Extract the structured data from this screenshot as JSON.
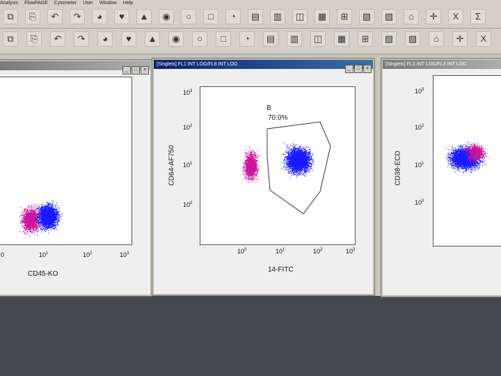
{
  "menu": {
    "items": [
      "Analysis",
      "FlowPAGE",
      "Cytometer",
      "User",
      "Window",
      "Help"
    ]
  },
  "toolbar": {
    "row1_icons": [
      "copy-icon",
      "paste-icon",
      "undo-icon",
      "redo-icon",
      "color-wheel-icon",
      "heart-icon",
      "shape-icon",
      "palette-icon",
      "circle-gate-icon",
      "square-gate-icon",
      "ellipse-gate-icon",
      "chart-a-icon",
      "grid-icon",
      "split-icon",
      "bars-icon",
      "quad-icon",
      "strike-icon",
      "rainbow-icon",
      "house-icon",
      "crosshair-icon",
      "excel-icon",
      "sigma-icon"
    ],
    "row2_icons": [
      "arrows-icon",
      "arrange-icon",
      "sort-icon",
      "distribute-icon",
      "align-left-icon",
      "align-center-icon",
      "align-right-icon",
      "move-icon",
      "display-icon",
      "report-icon",
      "calc-icon",
      "print-icon",
      "save-icon",
      "edit-icon",
      "tools-icon",
      "list-icon",
      "folder-icon",
      "word-icon",
      "book-icon",
      "cut-icon",
      "magnet-icon"
    ]
  },
  "windows": {
    "left": {
      "xlabel": "CD45-KO",
      "xticks": [
        "0",
        "1",
        "2",
        "3"
      ]
    },
    "center": {
      "title": "[Singlets] FL1 INT LOG/FL8 INT LOG",
      "xlabel": "14-FITC",
      "ylabel": "CD64-AF750",
      "gate_name": "B",
      "gate_pct": "70.0%",
      "xticks": [
        "0",
        "1",
        "2",
        "3"
      ],
      "yticks": [
        "0",
        "1",
        "2",
        "3"
      ]
    },
    "right": {
      "title": "[Singlets] FL2 INT LOG/FL3 INT LOG",
      "ylabel": "CD38-ECD",
      "yticks": [
        "0",
        "1",
        "2",
        "3"
      ]
    }
  },
  "colors": {
    "blue_pop": "#1a1aff",
    "magenta_pop": "#c8149c",
    "titlebar": "#0a246a"
  }
}
